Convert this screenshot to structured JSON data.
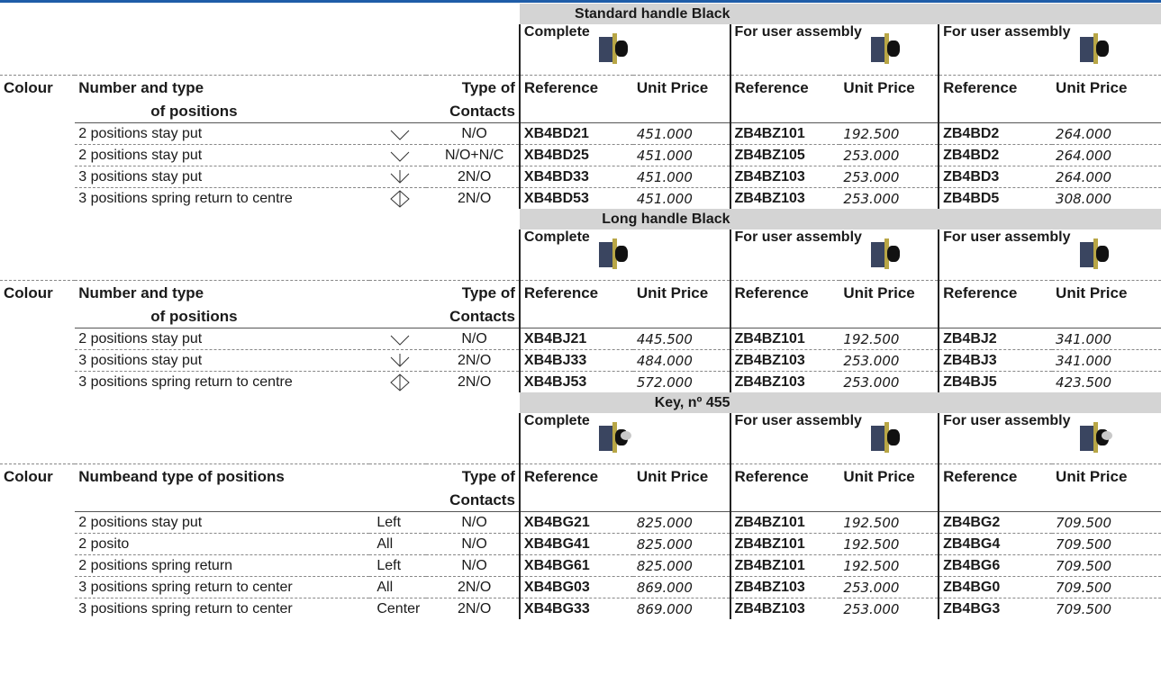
{
  "colors": {
    "top_bar": "#1f5da8",
    "section_bg": "#d4d4d4"
  },
  "sections": [
    {
      "title": "Standard handle Black",
      "groups": [
        "Complete",
        "For user assembly",
        "For user assembly"
      ],
      "head": {
        "colour": "Colour",
        "positions_1": "Number and type",
        "positions_2": "of positions",
        "contacts_1": "Type of",
        "contacts_2": "Contacts",
        "ref": "Reference",
        "price": "Unit Price"
      },
      "rows": [
        {
          "desc": "2 positions stay put",
          "icon": "two-position-icon",
          "contacts": "N/O",
          "r1": "XB4BD21",
          "p1": "451.000",
          "r2": "ZB4BZ101",
          "p2": "192.500",
          "r3": "ZB4BD2",
          "p3": "264.000"
        },
        {
          "desc": "2 positions stay put",
          "icon": "two-position-icon",
          "contacts": "N/O+N/C",
          "r1": "XB4BD25",
          "p1": "451.000",
          "r2": "ZB4BZ105",
          "p2": "253.000",
          "r3": "ZB4BD2",
          "p3": "264.000"
        },
        {
          "desc": "3 positions stay put",
          "icon": "three-position-icon",
          "contacts": "2N/O",
          "r1": "XB4BD33",
          "p1": "451.000",
          "r2": "ZB4BZ103",
          "p2": "253.000",
          "r3": "ZB4BD3",
          "p3": "264.000"
        },
        {
          "desc": "3 positions spring return to centre",
          "icon": "spring-return-icon",
          "contacts": "2N/O",
          "r1": "XB4BD53",
          "p1": "451.000",
          "r2": "ZB4BZ103",
          "p2": "253.000",
          "r3": "ZB4BD5",
          "p3": "308.000"
        }
      ]
    },
    {
      "title": "Long handle Black",
      "groups": [
        "Complete",
        "For user assembly",
        "For user assembly"
      ],
      "head": {
        "colour": "Colour",
        "positions_1": "Number and type",
        "positions_2": "of positions",
        "contacts_1": "Type of",
        "contacts_2": "Contacts",
        "ref": "Reference",
        "price": "Unit Price"
      },
      "rows": [
        {
          "desc": "2 positions stay put",
          "icon": "two-position-icon",
          "contacts": "N/O",
          "r1": "XB4BJ21",
          "p1": "445.500",
          "r2": "ZB4BZ101",
          "p2": "192.500",
          "r3": "ZB4BJ2",
          "p3": "341.000"
        },
        {
          "desc": "3 positions stay put",
          "icon": "three-position-icon",
          "contacts": "2N/O",
          "r1": "XB4BJ33",
          "p1": "484.000",
          "r2": "ZB4BZ103",
          "p2": "253.000",
          "r3": "ZB4BJ3",
          "p3": "341.000"
        },
        {
          "desc": "3 positions spring return to centre",
          "icon": "spring-return-icon",
          "contacts": "2N/O",
          "r1": "XB4BJ53",
          "p1": "572.000",
          "r2": "ZB4BZ103",
          "p2": "253.000",
          "r3": "ZB4BJ5",
          "p3": "423.500"
        }
      ]
    },
    {
      "title": "Key, nº 455",
      "groups": [
        "Complete",
        "For user assembly",
        "For user assembly"
      ],
      "head": {
        "colour": "Colour",
        "positions_1": "Numbeand type of positions",
        "positions_2": "",
        "contacts_1": "Type of",
        "contacts_2": "Contacts",
        "ref": "Reference",
        "price": "Unit Price"
      },
      "rows": [
        {
          "desc": "2 positions stay put",
          "key": "Left",
          "contacts": "N/O",
          "r1": "XB4BG21",
          "p1": "825.000",
          "r2": "ZB4BZ101",
          "p2": "192.500",
          "r3": "ZB4BG2",
          "p3": "709.500"
        },
        {
          "desc": "2 posito",
          "key": "All",
          "contacts": "N/O",
          "r1": "XB4BG41",
          "p1": "825.000",
          "r2": "ZB4BZ101",
          "p2": "192.500",
          "r3": "ZB4BG4",
          "p3": "709.500"
        },
        {
          "desc": "2 positions spring return",
          "key": "Left",
          "contacts": "N/O",
          "r1": "XB4BG61",
          "p1": "825.000",
          "r2": "ZB4BZ101",
          "p2": "192.500",
          "r3": "ZB4BG6",
          "p3": "709.500"
        },
        {
          "desc": "3 positions spring return to center",
          "key": "All",
          "contacts": "2N/O",
          "r1": "XB4BG03",
          "p1": "869.000",
          "r2": "ZB4BZ103",
          "p2": "253.000",
          "r3": "ZB4BG0",
          "p3": "709.500"
        },
        {
          "desc": "3 positions spring return to center",
          "key": "Center",
          "contacts": "2N/O",
          "r1": "XB4BG33",
          "p1": "869.000",
          "r2": "ZB4BZ103",
          "p2": "253.000",
          "r3": "ZB4BG3",
          "p3": "709.500"
        }
      ]
    }
  ]
}
